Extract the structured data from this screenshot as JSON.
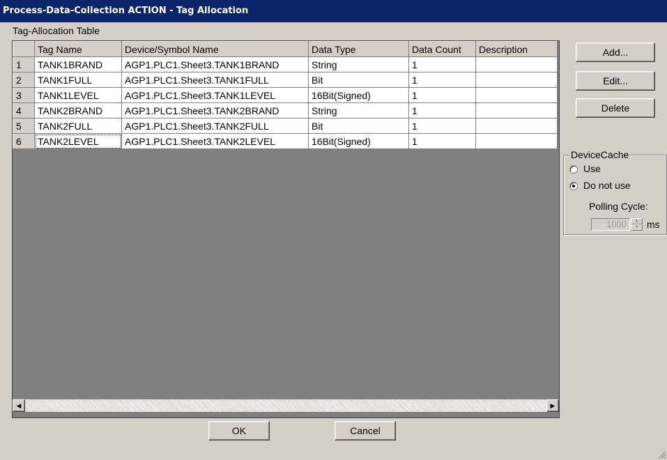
{
  "window": {
    "title": "Process-Data-Collection ACTION - Tag Allocation"
  },
  "table": {
    "label": "Tag-Allocation Table",
    "columns": [
      "",
      "Tag Name",
      "Device/Symbol Name",
      "Data Type",
      "Data Count",
      "Description"
    ],
    "rows": [
      {
        "num": "1",
        "tag": "TANK1BRAND",
        "device": "AGP1.PLC1.Sheet3.TANK1BRAND",
        "type": "String",
        "count": "1",
        "desc": ""
      },
      {
        "num": "2",
        "tag": "TANK1FULL",
        "device": "AGP1.PLC1.Sheet3.TANK1FULL",
        "type": "Bit",
        "count": "1",
        "desc": ""
      },
      {
        "num": "3",
        "tag": "TANK1LEVEL",
        "device": "AGP1.PLC1.Sheet3.TANK1LEVEL",
        "type": "16Bit(Signed)",
        "count": "1",
        "desc": ""
      },
      {
        "num": "4",
        "tag": "TANK2BRAND",
        "device": "AGP1.PLC1.Sheet3.TANK2BRAND",
        "type": "String",
        "count": "1",
        "desc": ""
      },
      {
        "num": "5",
        "tag": "TANK2FULL",
        "device": "AGP1.PLC1.Sheet3.TANK2FULL",
        "type": "Bit",
        "count": "1",
        "desc": ""
      },
      {
        "num": "6",
        "tag": "TANK2LEVEL",
        "device": "AGP1.PLC1.Sheet3.TANK2LEVEL",
        "type": "16Bit(Signed)",
        "count": "1",
        "desc": ""
      }
    ]
  },
  "buttons": {
    "add": "Add...",
    "edit": "Edit...",
    "delete": "Delete",
    "ok": "OK",
    "cancel": "Cancel"
  },
  "device_cache": {
    "title": "DeviceCache",
    "use_label": "Use",
    "not_use_label": "Do not use",
    "selected": "Do not use",
    "polling_label": "Polling Cycle:",
    "polling_value": "1000",
    "polling_unit": "ms"
  },
  "icons": {
    "scroll_left": "arrow-left-icon",
    "scroll_right": "arrow-right-icon",
    "spin": "spin-up-down-icon",
    "grip": "resize-grip-icon"
  }
}
